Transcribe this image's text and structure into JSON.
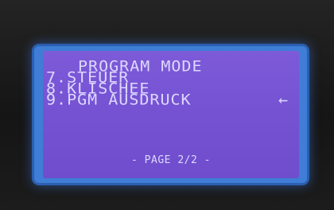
{
  "display": {
    "title": "PROGRAM MODE",
    "menu_items": [
      {
        "label": "7.STEUER"
      },
      {
        "label": "8.KLISCHEE"
      },
      {
        "label": "9.PGM AUSDRUCK"
      }
    ],
    "selection_arrow": "←",
    "page_indicator": "- PAGE 2/2 -"
  },
  "colors": {
    "backlight": "#7452d2",
    "text": "#ddd8ff",
    "bezel": "#3f7dd6"
  }
}
